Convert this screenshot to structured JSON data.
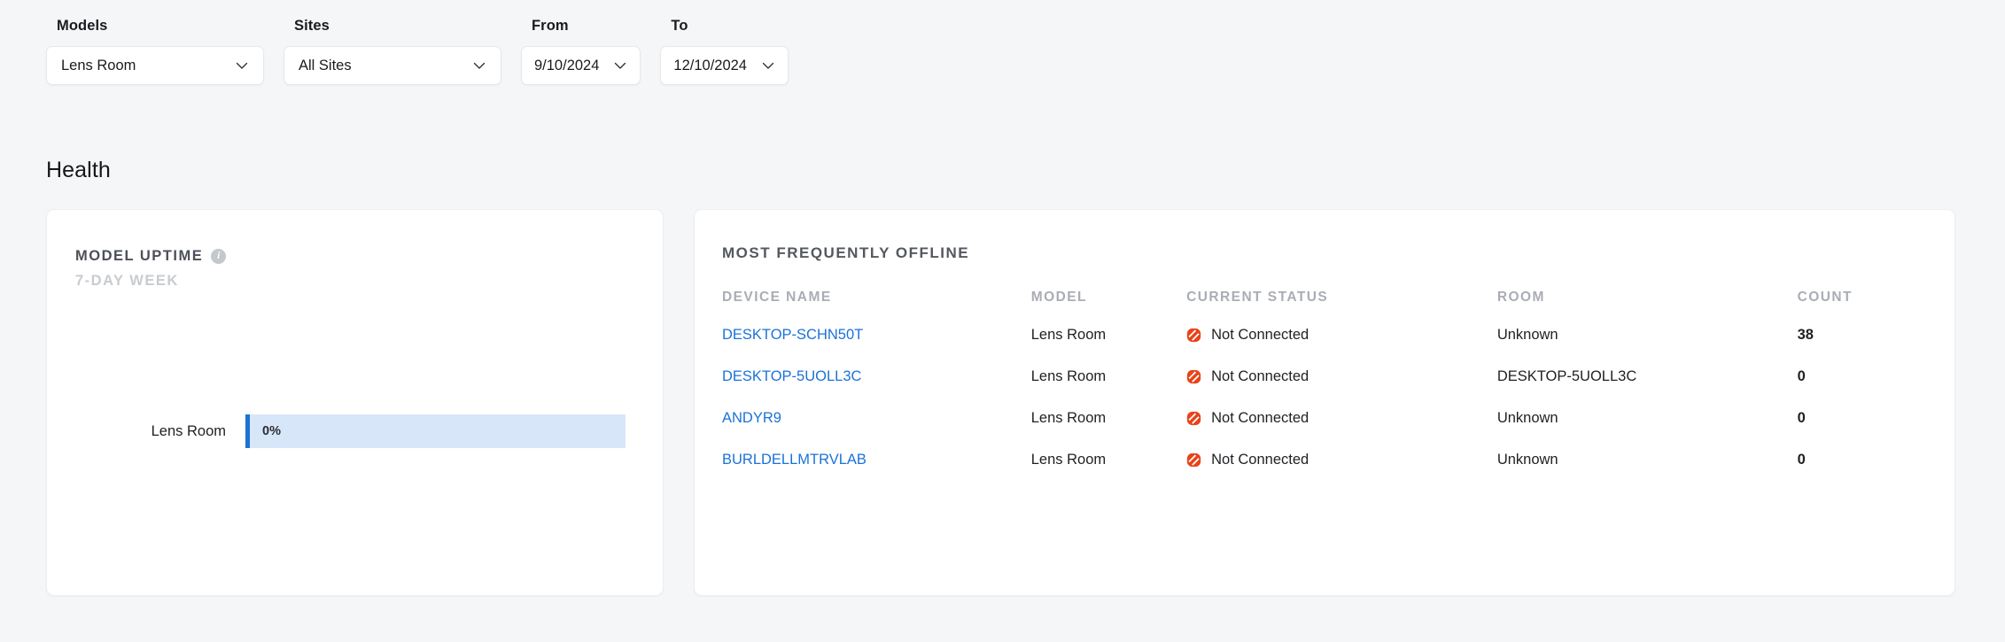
{
  "filters": [
    {
      "label": "Models",
      "value": "Lens Room",
      "type": "wide",
      "icon": "chevron-down-icon",
      "name": "models"
    },
    {
      "label": "Sites",
      "value": "All Sites",
      "type": "wide",
      "icon": "chevron-down-icon",
      "name": "sites"
    },
    {
      "label": "From",
      "value": "9/10/2024",
      "type": "date",
      "icon": "chevron-down-icon",
      "name": "from-date"
    },
    {
      "label": "To",
      "value": "12/10/2024",
      "type": "date",
      "icon": "chevron-down-icon",
      "name": "to-date"
    }
  ],
  "section": {
    "title": "Health"
  },
  "uptime_card": {
    "title": "MODEL UPTIME",
    "info_icon": "info-icon",
    "info_glyph": "i",
    "subtitle": "7-DAY WEEK",
    "bar_label": "Lens Room",
    "bar_value_label": "0%",
    "bar_percent": 0,
    "bar_color": "#1d72d3",
    "track_color": "#d7e6f9"
  },
  "offline_card": {
    "title": "MOST FREQUENTLY OFFLINE",
    "columns": [
      "DEVICE NAME",
      "MODEL",
      "CURRENT STATUS",
      "ROOM",
      "COUNT"
    ],
    "status_icon": "not-connected-icon",
    "status_color": "#e8441a",
    "rows": [
      {
        "device": "DESKTOP-SCHN50T",
        "model": "Lens Room",
        "status": "Not Connected",
        "room": "Unknown",
        "count": "38"
      },
      {
        "device": "DESKTOP-5UOLL3C",
        "model": "Lens Room",
        "status": "Not Connected",
        "room": "DESKTOP-5UOLL3C",
        "count": "0"
      },
      {
        "device": "ANDYR9",
        "model": "Lens Room",
        "status": "Not Connected",
        "room": "Unknown",
        "count": "0"
      },
      {
        "device": "BURLDELLMTRVLAB",
        "model": "Lens Room",
        "status": "Not Connected",
        "room": "Unknown",
        "count": "0"
      }
    ]
  },
  "chart_data": {
    "type": "bar",
    "title": "MODEL UPTIME",
    "subtitle": "7-DAY WEEK",
    "orientation": "horizontal",
    "categories": [
      "Lens Room"
    ],
    "values": [
      0
    ],
    "data_labels": [
      "0%"
    ],
    "xlabel": "",
    "ylabel": "",
    "xlim": [
      0,
      100
    ],
    "unit": "%",
    "grid": false,
    "legend": false
  }
}
